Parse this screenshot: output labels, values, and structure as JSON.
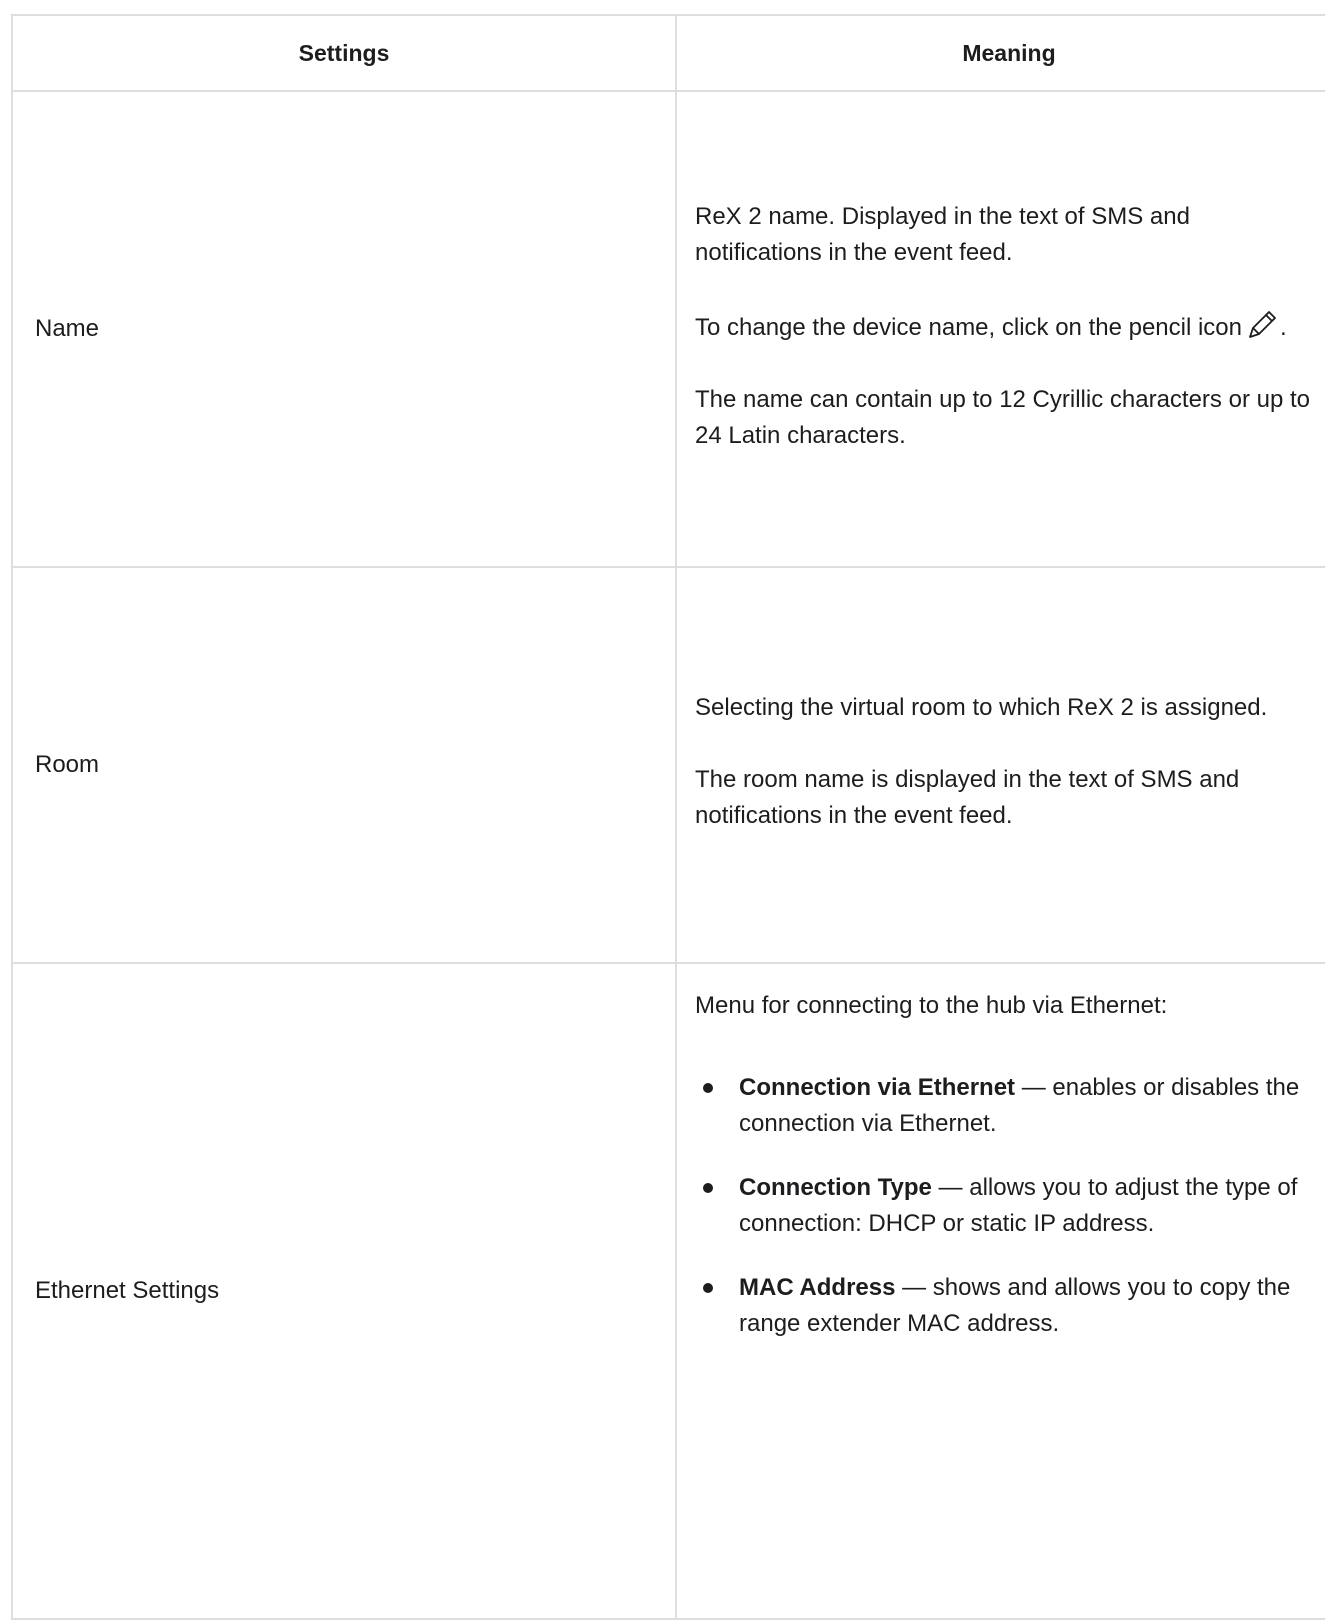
{
  "table": {
    "headers": {
      "settings": "Settings",
      "meaning": "Meaning"
    },
    "rows": [
      {
        "setting": "Name",
        "paragraphs": [
          "ReX 2 name. Displayed in the text of SMS and notifications in the event feed.",
          "To change the device name, click on the pencil icon",
          "The name can contain up to 12 Cyrillic characters or up to 24 Latin characters."
        ],
        "pencil_icon": "pencil-icon",
        "pencil_suffix": "."
      },
      {
        "setting": "Room",
        "paragraphs": [
          "Selecting the virtual room to which ReX 2 is assigned.",
          "The room name is displayed in the text of SMS and notifications in the event feed."
        ]
      },
      {
        "setting": "Ethernet Settings",
        "intro": "Menu for connecting to the hub via Ethernet:",
        "items": [
          {
            "term": "Connection via Ethernet",
            "desc": " — enables or disables the connection via Ethernet."
          },
          {
            "term": "Connection Type",
            "desc": " — allows you to adjust the type of connection: DHCP or static IP address."
          },
          {
            "term": "MAC Address",
            "desc": " — shows and allows you to copy the range extender MAC address."
          }
        ]
      }
    ]
  },
  "colors": {
    "border": "#dedede",
    "text": "#1d1d1f"
  }
}
